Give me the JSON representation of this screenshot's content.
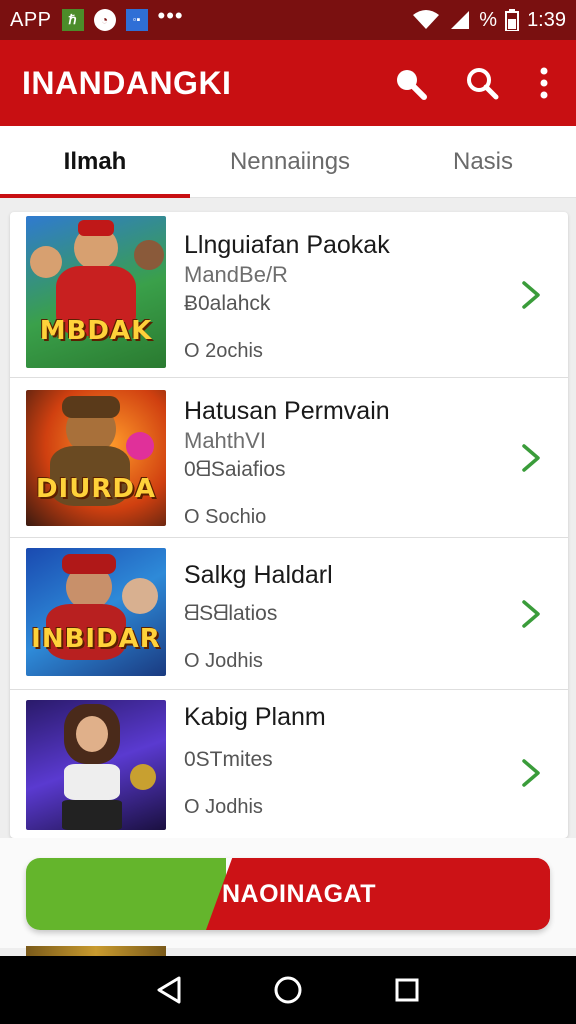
{
  "status_bar": {
    "app_label": "APP",
    "icons": [
      "green-app-icon",
      "round-app-icon",
      "blue-app-icon"
    ],
    "more": "•••",
    "battery_text": "%",
    "time": "1:39"
  },
  "app_bar": {
    "title": "INANDANGKI",
    "actions": [
      "search-icon",
      "search-icon",
      "more-vertical-icon"
    ]
  },
  "tabs": [
    {
      "label": "Ilmah",
      "active": true
    },
    {
      "label": "Nennaiings",
      "active": false
    },
    {
      "label": "Nasis",
      "active": false
    }
  ],
  "list": [
    {
      "thumb_title": "MBDAK",
      "title": "Llnguiafan Paokak",
      "sub": "MandBe/R",
      "meta": "Ƀ0alahck",
      "count": "O 2ochis"
    },
    {
      "thumb_title": "DIURDA",
      "title": "Hatusan Permvain",
      "sub": "MahthVI",
      "meta": "0ᗺSaiafios",
      "count": "O Sochio"
    },
    {
      "thumb_title": "INBIDAR",
      "title": "Salkg Haldarl",
      "sub": "",
      "meta": "ᗺSᗺlatios",
      "count": "O Jodhis"
    },
    {
      "thumb_title": "",
      "title": "Kabig Planm",
      "sub": "",
      "meta": "0STmites",
      "count": "O Jodhis"
    }
  ],
  "cta": {
    "label": "NAOINAGAT"
  },
  "colors": {
    "primary": "#c80f12",
    "status": "#7a1010",
    "accent_green": "#64b52c",
    "chevron": "#3a9c3a"
  },
  "nav": [
    "back-icon",
    "home-icon",
    "recents-icon"
  ]
}
